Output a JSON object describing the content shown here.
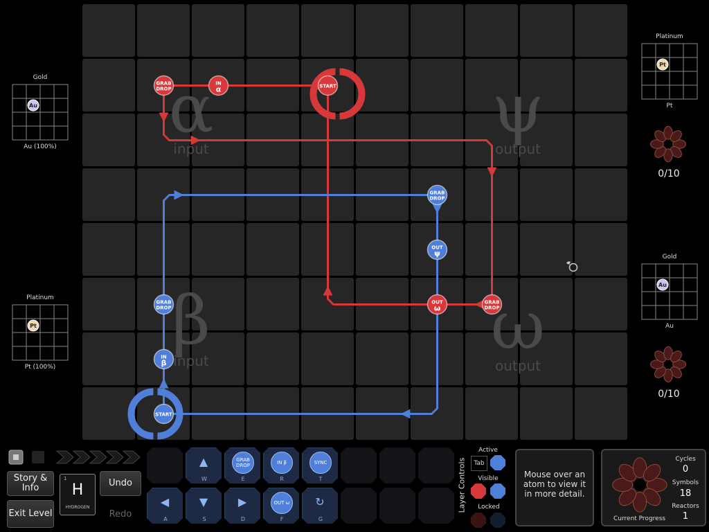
{
  "input_panels": [
    {
      "title": "Gold",
      "atom": "Au",
      "caption": "Au (100%)"
    },
    {
      "title": "Platinum",
      "atom": "Pt",
      "caption": "Pt (100%)"
    }
  ],
  "output_panels": [
    {
      "title": "Platinum",
      "atom": "Pt",
      "caption": "Pt",
      "count": "0/10"
    },
    {
      "title": "Gold",
      "atom": "Au",
      "caption": "Au",
      "count": "0/10"
    }
  ],
  "zones": {
    "alpha": {
      "symbol": "α",
      "label": "input"
    },
    "beta": {
      "symbol": "β",
      "label": "input"
    },
    "psi": {
      "symbol": "ψ",
      "label": "output"
    },
    "omega": {
      "symbol": "ω",
      "label": "output"
    }
  },
  "red_waldo": {
    "start": "START",
    "grab_drop_1": [
      "GRAB",
      "DROP"
    ],
    "in_alpha": [
      "IN",
      "α"
    ],
    "out_omega": [
      "OUT",
      "ω"
    ],
    "grab_drop_2": [
      "GRAB",
      "DROP"
    ]
  },
  "blue_waldo": {
    "start": "START",
    "grab_drop_1": [
      "GRAB",
      "DROP"
    ],
    "in_beta": [
      "IN",
      "β"
    ],
    "out_psi": [
      "OUT",
      "ψ"
    ],
    "grab_drop_2": [
      "GRAB",
      "DROP"
    ]
  },
  "controls": {
    "story": "Story & Info",
    "exit": "Exit Level",
    "undo": "Undo",
    "redo": "Redo",
    "element_symbol": "H",
    "element_number": "1",
    "element_name": "HYDROGEN"
  },
  "tools": [
    {
      "label": "",
      "key": "W",
      "glyph": "▲"
    },
    {
      "label": "GRAB DROP",
      "key": "E"
    },
    {
      "label": "IN β",
      "key": "R"
    },
    {
      "label": "SYNC",
      "key": "T"
    },
    {
      "label": "",
      "key": "A",
      "glyph": "◀"
    },
    {
      "label": "",
      "key": "S",
      "glyph": "▼"
    },
    {
      "label": "",
      "key": "D",
      "glyph": "▶"
    },
    {
      "label": "OUT ω",
      "key": "F"
    },
    {
      "label": "",
      "key": "G",
      "glyph": "↻"
    }
  ],
  "layers": {
    "title": "Layer Controls",
    "active": "Active",
    "tab": "Tab",
    "visible": "Visible",
    "locked": "Locked"
  },
  "hint": "Mouse over an atom to view it in more detail.",
  "stats": {
    "cycles_label": "Cycles",
    "cycles": "0",
    "symbols_label": "Symbols",
    "symbols": "18",
    "reactors_label": "Reactors",
    "reactors": "1",
    "progress_label": "Current Progress"
  },
  "colors": {
    "red": "#d9383a",
    "blue": "#4f7fd8",
    "cell": "#262626"
  }
}
